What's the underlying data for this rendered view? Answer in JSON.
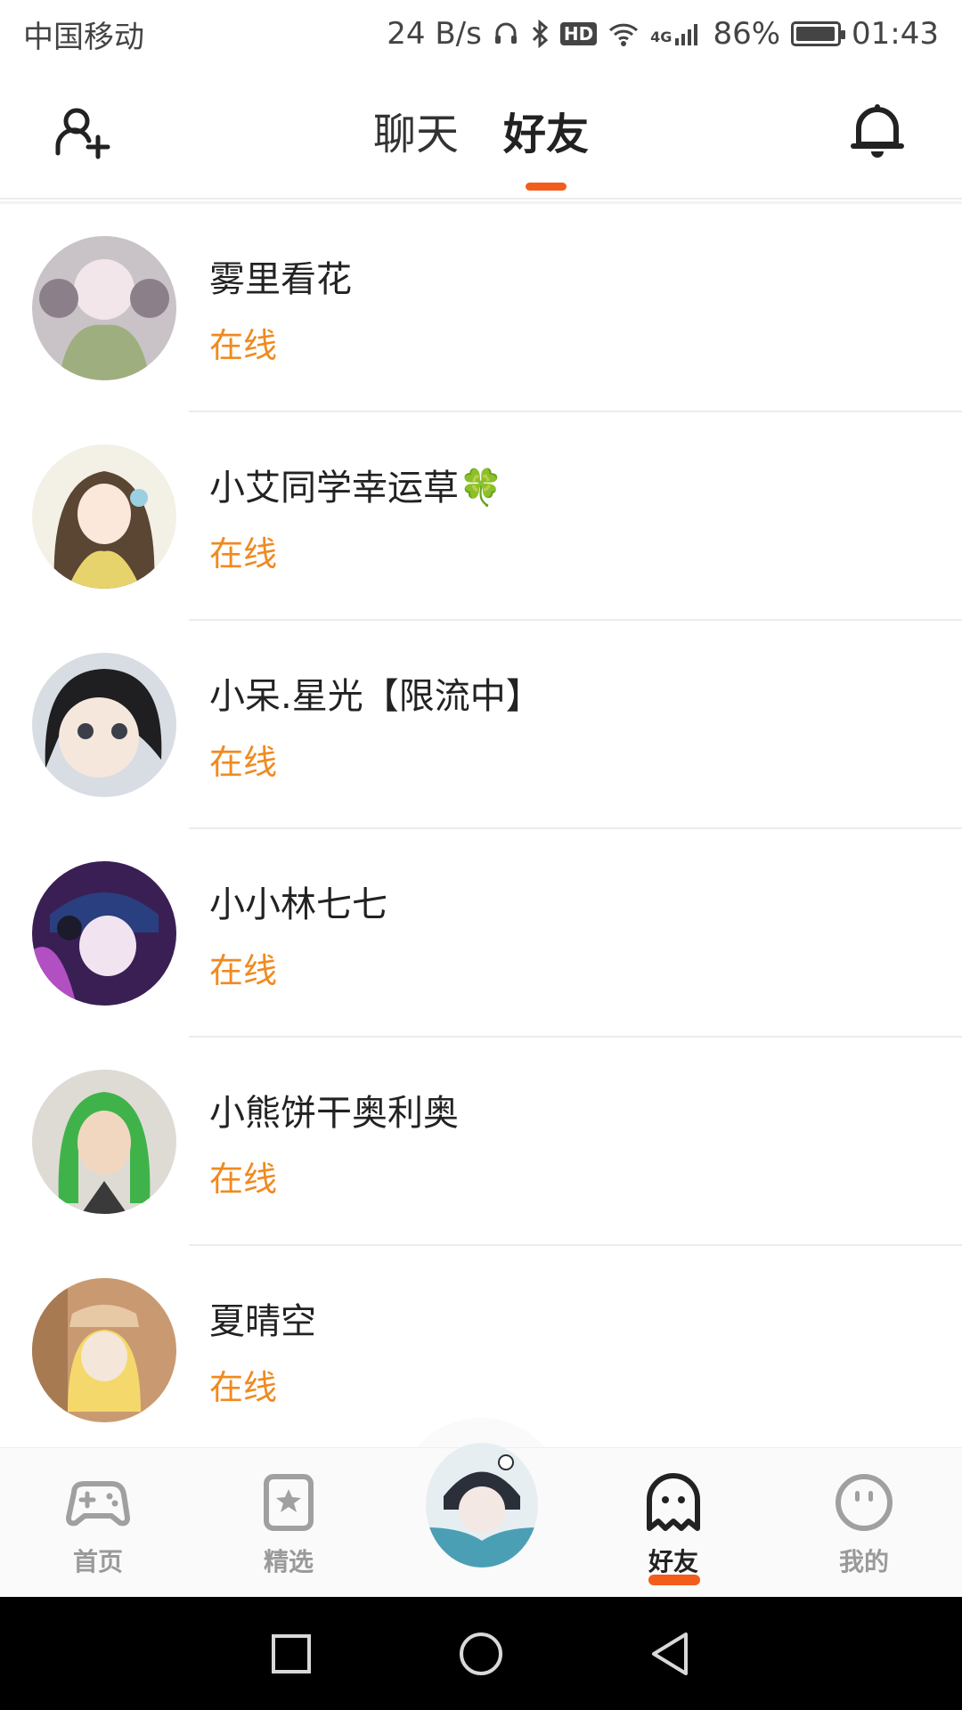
{
  "status_bar": {
    "carrier": "中国移动",
    "speed": "24 B/s",
    "hd": "HD",
    "network": "4G",
    "battery_text": "86%",
    "battery_level": 0.86,
    "time": "01:43"
  },
  "header": {
    "tabs": [
      {
        "label": "聊天",
        "active": false
      },
      {
        "label": "好友",
        "active": true
      }
    ],
    "accent_color": "#f25d1c"
  },
  "friends": [
    {
      "name": "雾里看花",
      "status": "在线",
      "avatar_colors": [
        "#c9c3c8",
        "#8b7f8a",
        "#9fae7f"
      ]
    },
    {
      "name": "小艾同学幸运草",
      "name_emoji": "🍀",
      "status": "在线",
      "avatar_colors": [
        "#f3f0e6",
        "#5a4633",
        "#e7d36b"
      ]
    },
    {
      "name": "小呆.星光【限流中】",
      "status": "在线",
      "avatar_colors": [
        "#d8dde3",
        "#1f1f22",
        "#f6e7dc"
      ]
    },
    {
      "name": "小小林七七",
      "status": "在线",
      "avatar_colors": [
        "#3a1f55",
        "#2a3f7f",
        "#b24fc2"
      ]
    },
    {
      "name": "小熊饼干奥利奥",
      "status": "在线",
      "avatar_colors": [
        "#dedbd5",
        "#3fb34a",
        "#f2d7c0"
      ]
    },
    {
      "name": "夏晴空",
      "status": "在线",
      "avatar_colors": [
        "#c99a72",
        "#f5d86b",
        "#f4e6d9"
      ]
    }
  ],
  "status_color": "#f08a1f",
  "bottom_nav": {
    "items": [
      {
        "label": "首页",
        "icon": "gamepad-icon",
        "active": false
      },
      {
        "label": "精选",
        "icon": "star-card-icon",
        "active": false
      },
      {
        "label": "好友",
        "icon": "ghost-icon",
        "active": true
      },
      {
        "label": "我的",
        "icon": "face-icon",
        "active": false
      }
    ]
  },
  "system_nav": [
    "square-icon",
    "circle-icon",
    "triangle-back-icon"
  ]
}
